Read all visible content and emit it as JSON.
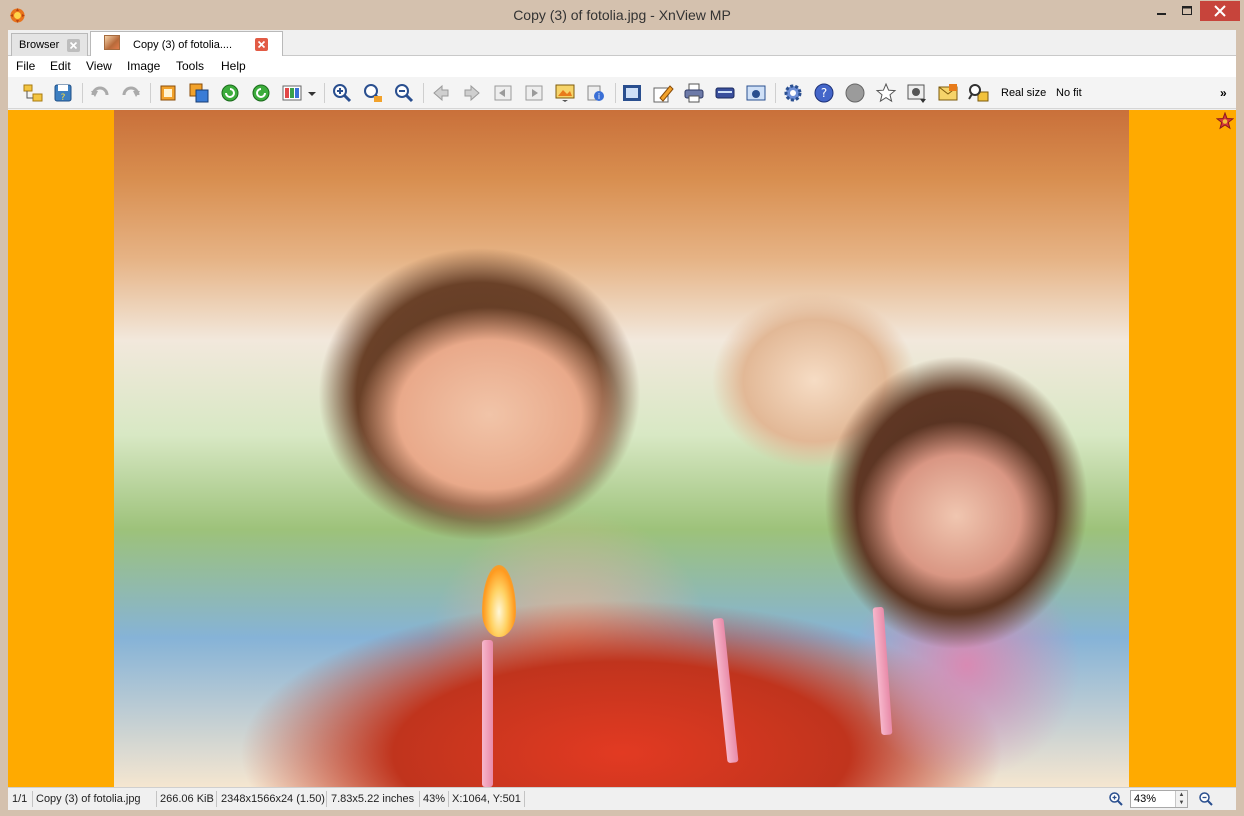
{
  "window": {
    "title": "Copy (3) of fotolia.jpg - XnView MP"
  },
  "tabs": [
    {
      "label": "Browser"
    },
    {
      "label": "Copy (3) of fotolia...."
    }
  ],
  "menu": [
    "File",
    "Edit",
    "View",
    "Image",
    "Tools",
    "Help"
  ],
  "toolbar": {
    "real_size_label": "Real size",
    "no_fit_label": "No fit",
    "more_label": "»"
  },
  "status": {
    "index": "1/1",
    "filename": "Copy (3) of fotolia.jpg",
    "filesize": "266.06 KiB",
    "dimensions": "2348x1566x24 (1.50)",
    "print_size": "7.83x5.22 inches",
    "zoom_percent": "43%",
    "cursor": "X:1064, Y:501",
    "zoom_field": "43%"
  },
  "colors": {
    "viewer_background": "#ffaa00",
    "frame": "#d4c1ae",
    "close_button": "#c7443b"
  }
}
